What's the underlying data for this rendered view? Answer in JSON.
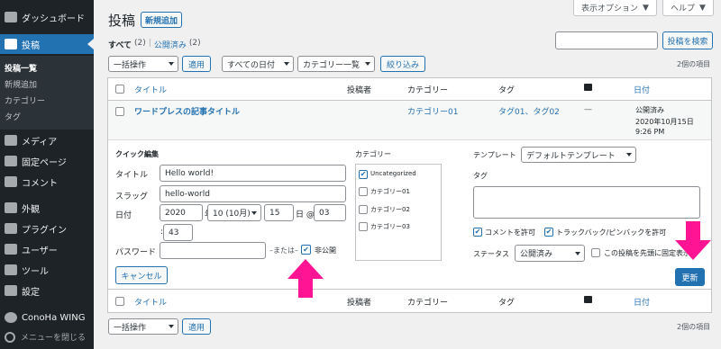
{
  "sidebar": {
    "items": [
      {
        "label": "ダッシュボード",
        "icon": "dashboard-icon"
      },
      {
        "label": "投稿",
        "icon": "pin-icon"
      },
      {
        "label": "メディア",
        "icon": "media-icon"
      },
      {
        "label": "固定ページ",
        "icon": "page-icon"
      },
      {
        "label": "コメント",
        "icon": "comment-icon"
      },
      {
        "label": "外観",
        "icon": "brush-icon"
      },
      {
        "label": "プラグイン",
        "icon": "plugin-icon"
      },
      {
        "label": "ユーザー",
        "icon": "user-icon"
      },
      {
        "label": "ツール",
        "icon": "wrench-icon"
      },
      {
        "label": "設定",
        "icon": "settings-icon"
      },
      {
        "label": "ConoHa WING",
        "icon": "conoha-icon"
      }
    ],
    "submenu": [
      "投稿一覧",
      "新規追加",
      "カテゴリー",
      "タグ"
    ],
    "collapse": "メニューを閉じる"
  },
  "header": {
    "title": "投稿",
    "add_new": "新規追加",
    "screen_options": "表示オプション",
    "help": "ヘルプ"
  },
  "filters": {
    "all": "すべて",
    "all_count": "(2)",
    "sep": "|",
    "published": "公開済み",
    "published_count": "(2)"
  },
  "search": {
    "value": "",
    "button": "投稿を検索"
  },
  "toolbar": {
    "bulk": "一括操作",
    "apply": "適用",
    "dates": "すべての日付",
    "cats": "カテゴリー一覧",
    "filter": "絞り込み",
    "count": "2個の項目"
  },
  "table": {
    "columns": [
      "タイトル",
      "投稿者",
      "カテゴリー",
      "タグ",
      "日付"
    ],
    "row": {
      "title": "ワードプレスの記事タイトル",
      "category": "カテゴリー01",
      "tags": "タグ01、タグ02",
      "comments": "—",
      "status": "公開済み",
      "date": "2020年10月15日",
      "time": "9:26 PM"
    }
  },
  "quick_edit": {
    "heading": "クイック編集",
    "title_label": "タイトル",
    "title_value": "Hello world!",
    "slug_label": "スラッグ",
    "slug_value": "hello-world",
    "date_label": "日付",
    "year": "2020",
    "year_unit": "年",
    "month": "10 (10月)",
    "day": "15",
    "day_unit": "日 @",
    "hour": "03",
    "colon": ":",
    "minute": "43",
    "password_label": "パスワード",
    "or_text": "–または–",
    "private_label": "非公開",
    "cancel": "キャンセル",
    "categories_label": "カテゴリー",
    "categories": [
      "Uncategorized",
      "カテゴリー01",
      "カテゴリー02",
      "カテゴリー03"
    ],
    "template_label": "テンプレート",
    "template_value": "デフォルトテンプレート",
    "tags_label": "タグ",
    "allow_comments": "コメントを許可",
    "allow_pings": "トラックバック/ピンバックを許可",
    "status_label": "ステータス",
    "status_value": "公開済み",
    "sticky": "この投稿を先頭に固定表示",
    "update": "更新"
  },
  "colors": {
    "accent": "#2271b1",
    "arrow": "#ff1493",
    "sidebar": "#1d2327"
  }
}
